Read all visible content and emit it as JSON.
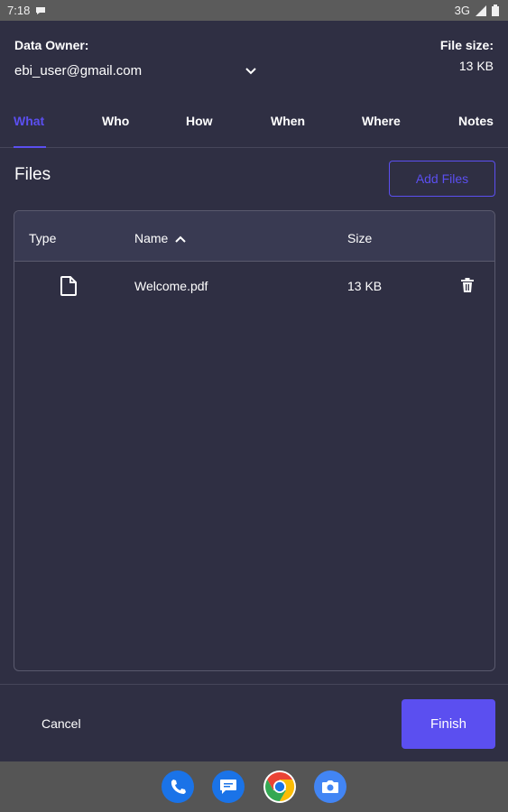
{
  "status_bar": {
    "time": "7:18",
    "network": "3G"
  },
  "owner": {
    "label": "Data Owner:",
    "value": "ebi_user@gmail.com"
  },
  "file_size": {
    "label": "File size:",
    "value": "13 KB"
  },
  "tabs": [
    {
      "label": "What",
      "active": true
    },
    {
      "label": "Who"
    },
    {
      "label": "How"
    },
    {
      "label": "When"
    },
    {
      "label": "Where"
    },
    {
      "label": "Notes"
    }
  ],
  "files": {
    "title": "Files",
    "add_button": "Add Files",
    "columns": [
      "Type",
      "Name",
      "Size"
    ],
    "rows": [
      {
        "name": "Welcome.pdf",
        "size": "13 KB",
        "type_icon": "file-icon"
      }
    ]
  },
  "footer": {
    "cancel": "Cancel",
    "finish": "Finish"
  },
  "dock": [
    "phone-icon",
    "messages-icon",
    "chrome-icon",
    "camera-icon"
  ],
  "colors": {
    "accent": "#5b4ff0",
    "background": "#2f2f43",
    "table_header": "#393a52"
  }
}
